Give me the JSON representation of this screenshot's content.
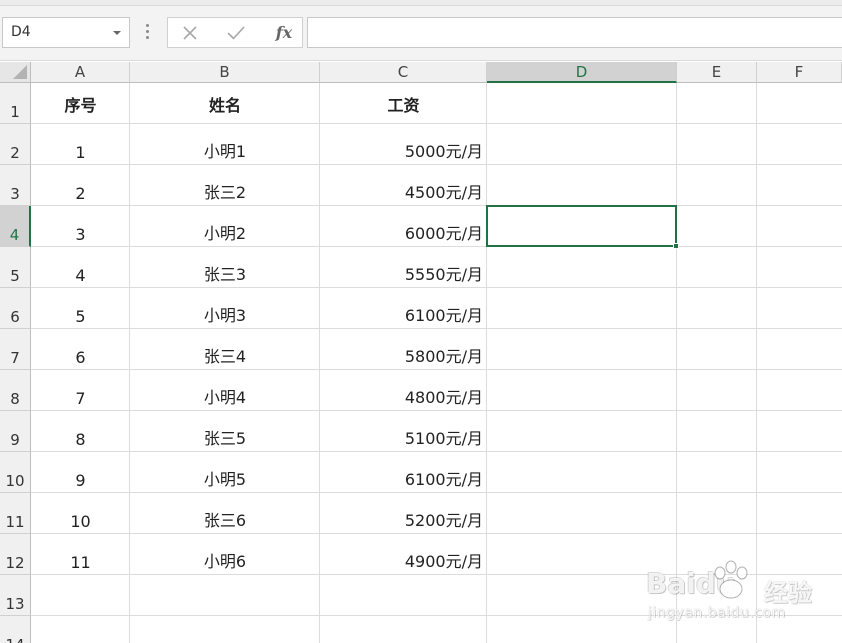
{
  "formula_bar": {
    "name_box": "D4",
    "cancel_icon": "close-icon",
    "confirm_icon": "checkmark-icon",
    "fx_label": "fx",
    "formula": ""
  },
  "columns": [
    "A",
    "B",
    "C",
    "D",
    "E",
    "F"
  ],
  "active_column": "D",
  "rows": [
    "1",
    "2",
    "3",
    "4",
    "5",
    "6",
    "7",
    "8",
    "9",
    "10",
    "11",
    "12",
    "13",
    "14"
  ],
  "active_row": "4",
  "table": {
    "headers": [
      "序号",
      "姓名",
      "工资"
    ],
    "rows": [
      [
        "1",
        "小明1",
        "5000元/月"
      ],
      [
        "2",
        "张三2",
        "4500元/月"
      ],
      [
        "3",
        "小明2",
        "6000元/月"
      ],
      [
        "4",
        "张三3",
        "5550元/月"
      ],
      [
        "5",
        "小明3",
        "6100元/月"
      ],
      [
        "6",
        "张三4",
        "5800元/月"
      ],
      [
        "7",
        "小明4",
        "4800元/月"
      ],
      [
        "8",
        "张三5",
        "5100元/月"
      ],
      [
        "9",
        "小明5",
        "6100元/月"
      ],
      [
        "10",
        "张三6",
        "5200元/月"
      ],
      [
        "11",
        "小明6",
        "4900元/月"
      ]
    ]
  },
  "selected_cell": "D4",
  "colors": {
    "accent": "#217346",
    "header_bg": "#f0f0f0",
    "active_header_bg": "#d2d2d2"
  },
  "watermark": {
    "logo": "Baidu",
    "brand": "经验",
    "url": "jingyan.baidu.com"
  }
}
